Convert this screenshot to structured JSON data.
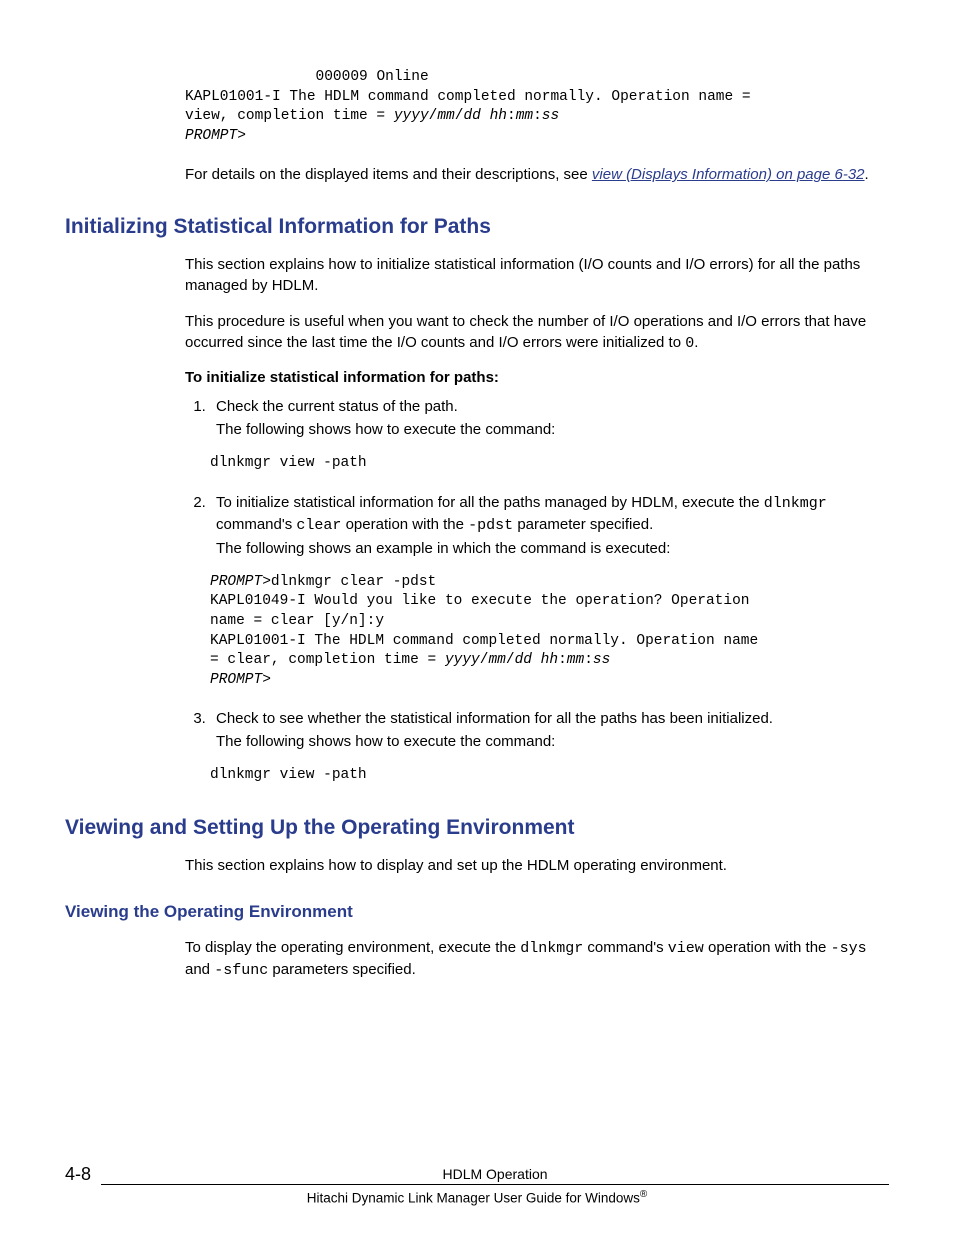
{
  "topCode": {
    "line1_pre": "               000009 Online",
    "line2": "KAPL01001-I The HDLM command completed normally. Operation name = ",
    "line3_a": "view, completion time = ",
    "line3_b": "yyyy",
    "line3_c": "/",
    "line3_d": "mm",
    "line3_e": "/",
    "line3_f": "dd hh",
    "line3_g": ":",
    "line3_h": "mm",
    "line3_i": ":",
    "line3_j": "ss",
    "prompt": "PROMPT",
    "gt": ">"
  },
  "para1": {
    "pre": "For details on the displayed items and their descriptions, see ",
    "link": "view (Displays Information) on page 6-32",
    "post": "."
  },
  "section1": {
    "title": "Initializing Statistical Information for Paths",
    "p1": "This section explains how to initialize statistical information (I/O counts and I/O errors) for all the paths managed by HDLM.",
    "p2a": "This procedure is useful when you want to check the number of I/O operations and I/O errors that have occurred since the last time the I/O counts and I/O errors were initialized to ",
    "p2zero": "0",
    "p2b": ".",
    "bold": "To initialize statistical information for paths:",
    "step1": {
      "l1": "Check the current status of the path.",
      "l2": "The following shows how to execute the command:",
      "cmd": "dlnkmgr view -path"
    },
    "step2": {
      "l1a": "To initialize statistical information for all the paths managed by HDLM, execute the ",
      "l1b": "dlnkmgr",
      "l1c": " command's ",
      "l1d": "clear",
      "l1e": " operation with the ",
      "l1f": "-pdst",
      "l1g": " parameter specified.",
      "l2": "The following shows an example in which the command is executed:",
      "code": {
        "c1a": "PROMPT",
        "c1b": ">dlnkmgr clear -pdst",
        "c2": "KAPL01049-I Would you like to execute the operation? Operation ",
        "c3": "name = clear [y/n]:y",
        "c4": "KAPL01001-I The HDLM command completed normally. Operation name ",
        "c5a": "= clear, completion time = ",
        "c5b": "yyyy",
        "c5c": "/",
        "c5d": "mm",
        "c5e": "/",
        "c5f": "dd hh",
        "c5g": ":",
        "c5h": "mm",
        "c5i": ":",
        "c5j": "ss",
        "c6a": "PROMPT",
        "c6b": ">"
      }
    },
    "step3": {
      "l1": "Check to see whether the statistical information for all the paths has been initialized.",
      "l2": "The following shows how to execute the command:",
      "cmd": "dlnkmgr view -path"
    }
  },
  "section2": {
    "title": "Viewing and Setting Up the Operating Environment",
    "p1": "This section explains how to display and set up the HDLM operating environment.",
    "sub": {
      "title": "Viewing the Operating Environment",
      "p1a": "To display the operating environment, execute the ",
      "p1b": "dlnkmgr",
      "p1c": " command's ",
      "p1d": "view",
      "p1e": " operation with the ",
      "p1f": "-sys",
      "p1g": " and ",
      "p1h": "-sfunc",
      "p1i": " parameters specified."
    }
  },
  "footer": {
    "pageno": "4-8",
    "chapter": "HDLM Operation",
    "guide": "Hitachi Dynamic Link Manager User Guide for Windows",
    "reg": "®"
  }
}
